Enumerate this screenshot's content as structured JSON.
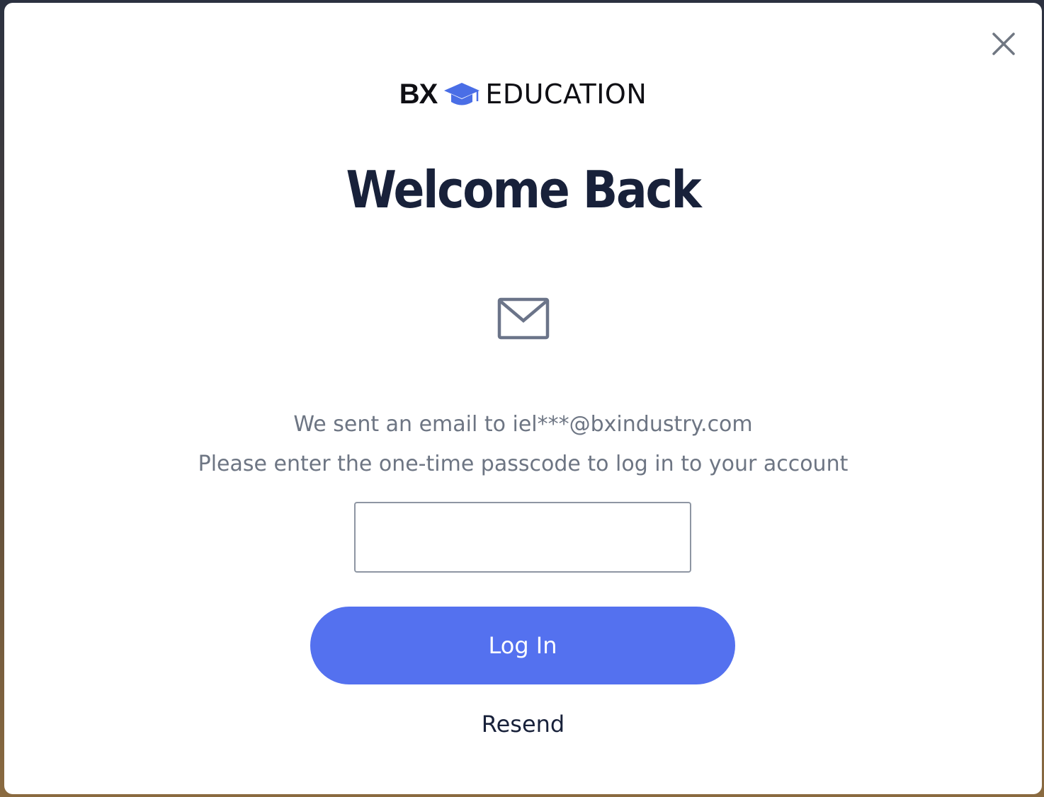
{
  "brand": {
    "mark": "BX",
    "name": "EDUCATION",
    "icon": "graduation-cap-icon",
    "icon_color": "#4a6ee6"
  },
  "modal": {
    "close_icon": "close-icon",
    "title": "Welcome Back",
    "mail_icon": "envelope-icon",
    "message_line_1": "We sent an email to iel***@bxindustry.com",
    "message_line_2": "Please enter the one-time passcode to log in to your account"
  },
  "otp": {
    "value": "",
    "placeholder": ""
  },
  "actions": {
    "login_label": "Log In",
    "resend_label": "Resend"
  },
  "colors": {
    "accent": "#5471ef",
    "title": "#18213a",
    "muted_text": "#6d7583"
  }
}
